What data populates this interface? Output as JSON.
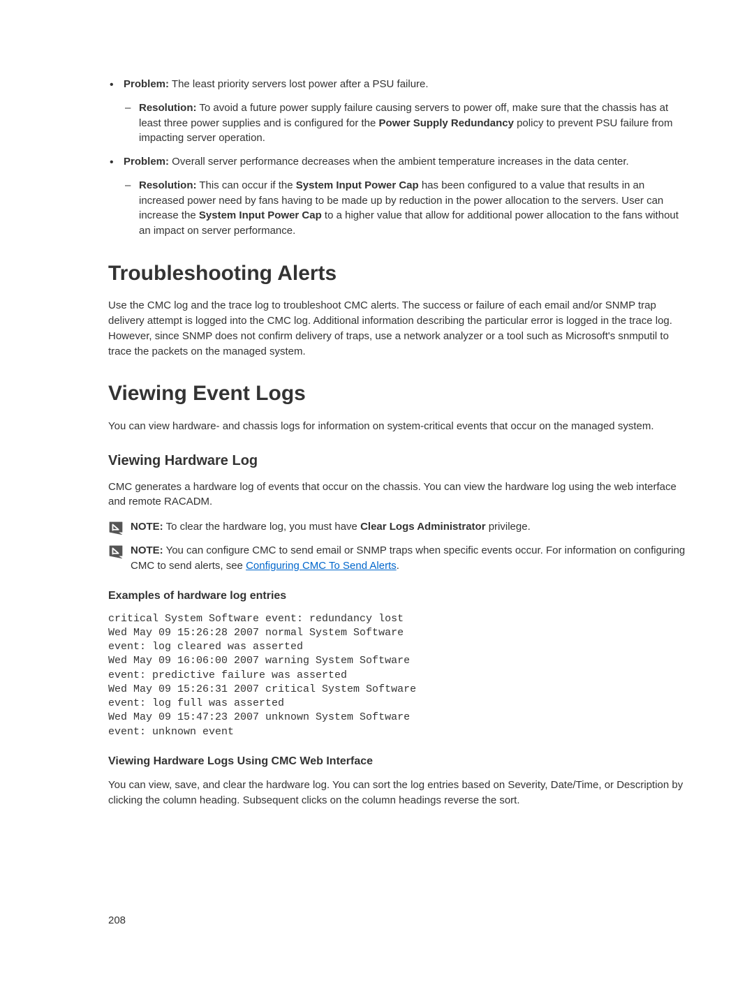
{
  "bullets": [
    {
      "label": "Problem:",
      "text": " The least priority servers lost power after a PSU failure.",
      "sub": [
        {
          "label": "Resolution:",
          "text_before_bold": " To avoid a future power supply failure causing servers to power off, make sure that the chassis has at least three power supplies and is configured for the ",
          "bold_mid": "Power Supply Redundancy",
          "text_after_bold": " policy to prevent PSU failure from impacting server operation."
        }
      ]
    },
    {
      "label": "Problem:",
      "text": " Overall server performance decreases when the ambient temperature increases in the data center.",
      "sub": [
        {
          "label": "Resolution:",
          "text_before_bold": " This can occur if the ",
          "bold_mid": "System Input Power Cap",
          "text_mid": " has been configured to a value that results in an increased power need by fans having to be made up by reduction in the power allocation to the servers. User can increase the ",
          "bold_mid2": "System Input Power Cap",
          "text_after_bold": " to a higher value that allow for additional power allocation to the fans without an impact on server performance."
        }
      ]
    }
  ],
  "headings": {
    "h1_troubleshooting": "Troubleshooting Alerts",
    "h1_viewing_event_logs": "Viewing Event Logs",
    "h2_viewing_hardware": "Viewing Hardware Log",
    "h3_viewing_hardware_web": "Viewing Hardware Logs Using CMC Web Interface"
  },
  "paragraphs": {
    "troubleshooting": "Use the CMC log and the trace log to troubleshoot CMC alerts. The success or failure of each email and/or SNMP trap delivery attempt is logged into the CMC log. Additional information describing the particular error is logged in the trace log. However, since SNMP does not confirm delivery of traps, use a network analyzer or a tool such as Microsoft's snmputil to trace the packets on the managed system.",
    "viewing_event_logs": "You can view hardware- and chassis logs for information on system-critical events that occur on the managed system.",
    "viewing_hardware": "CMC generates a hardware log of events that occur on the chassis. You can view the hardware log using the web interface and remote RACADM.",
    "examples_heading": "Examples of hardware log entries",
    "web_interface": "You can view, save, and clear the hardware log. You can sort the log entries based on Severity, Date/Time, or Description by clicking the column heading. Subsequent clicks on the column headings reverse the sort."
  },
  "notes": {
    "note1_prefix": "NOTE:",
    "note1_text_before": " To clear the hardware log, you must have ",
    "note1_bold": "Clear Logs Administrator",
    "note1_text_after": " privilege.",
    "note2_prefix": "NOTE:",
    "note2_text_before": " You can configure CMC to send email or SNMP traps when specific events occur. For information on configuring CMC to send alerts, see ",
    "note2_link": "Configuring CMC To Send Alerts",
    "note2_text_after": "."
  },
  "code": "critical System Software event: redundancy lost\nWed May 09 15:26:28 2007 normal System Software\nevent: log cleared was asserted\nWed May 09 16:06:00 2007 warning System Software\nevent: predictive failure was asserted\nWed May 09 15:26:31 2007 critical System Software\nevent: log full was asserted\nWed May 09 15:47:23 2007 unknown System Software\nevent: unknown event",
  "page_number": "208"
}
